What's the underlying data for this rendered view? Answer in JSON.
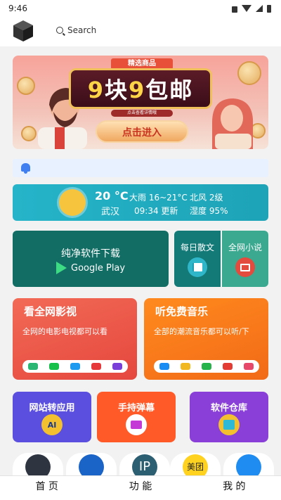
{
  "status_bar": {
    "time": "9:46"
  },
  "header": {
    "search_label": "Search"
  },
  "banner": {
    "ribbon": "精选商品",
    "title_a": "9",
    "title_b": "块",
    "title_c": "9",
    "title_d": "包邮",
    "subtitle": "点击查看详情哦",
    "cta": "点击进入"
  },
  "weather": {
    "temp": "20 °C",
    "city": "武汉",
    "condition": "大雨 16~21°C",
    "update": "09:34 更新",
    "wind": "北风 2级",
    "humidity": "湿度 95%"
  },
  "google_play_card": {
    "title": "纯净软件下载",
    "store": "Google Play"
  },
  "essay_card": {
    "title": "每日散文"
  },
  "novel_card": {
    "title": "全网小说"
  },
  "video_card": {
    "title": "看全网影视",
    "desc": "全网的电影电视都可以看"
  },
  "music_card": {
    "title": "听免费音乐",
    "desc": "全部的潮流音乐都可以听/下"
  },
  "tools": [
    {
      "title": "网站转应用"
    },
    {
      "title": "手持弹幕"
    },
    {
      "title": "软件仓库"
    }
  ],
  "dock_labels": {
    "ip": "IP",
    "meituan": "美团"
  },
  "bottom_nav": [
    {
      "label": "首 页"
    },
    {
      "label": "功 能"
    },
    {
      "label": "我 的"
    }
  ],
  "colors": {
    "weather": "#25b4c9",
    "google_play": "#126d64",
    "video": "#e5473e",
    "music": "#f26a17",
    "tool_1": "#5b4fe0",
    "tool_2": "#ff5a28",
    "tool_3": "#8a3fd8"
  }
}
